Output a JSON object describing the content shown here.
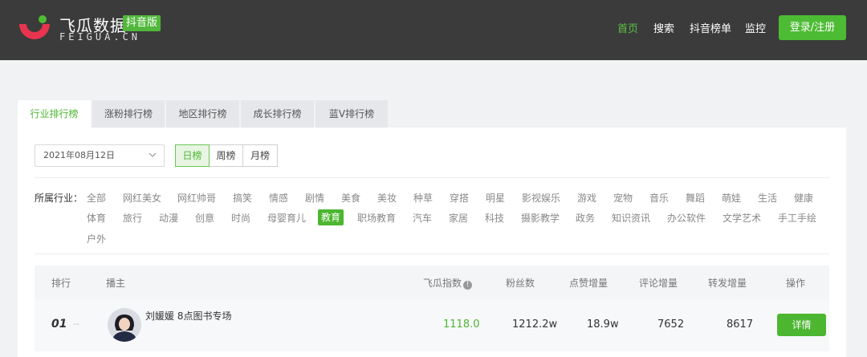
{
  "brand": {
    "name": "飞瓜数据",
    "badge": "抖音版",
    "sub": "FEIGUA.CN"
  },
  "nav": {
    "home": "首页",
    "search": "搜索",
    "rank": "抖音榜单",
    "monitor": "监控",
    "login": "登录/注册"
  },
  "tabs": [
    "行业排行榜",
    "涨粉排行榜",
    "地区排行榜",
    "成长排行榜",
    "蓝V排行榜"
  ],
  "filters": {
    "date": "2021年08月12日",
    "periods": [
      "日榜",
      "周榜",
      "月榜"
    ]
  },
  "industry": {
    "label": "所属行业：",
    "categories": [
      "全部",
      "网红美女",
      "网红帅哥",
      "搞笑",
      "情感",
      "剧情",
      "美食",
      "美妆",
      "种草",
      "穿搭",
      "明星",
      "影视娱乐",
      "游戏",
      "宠物",
      "音乐",
      "舞蹈",
      "萌娃",
      "生活",
      "健康",
      "体育",
      "旅行",
      "动漫",
      "创意",
      "时尚",
      "母婴育儿",
      "教育",
      "职场教育",
      "汽车",
      "家居",
      "科技",
      "摄影教学",
      "政务",
      "知识资讯",
      "办公软件",
      "文学艺术",
      "手工手绘",
      "户外"
    ],
    "active": "教育"
  },
  "table": {
    "headers": {
      "rank": "排行",
      "streamer": "播主",
      "index": "飞瓜指数",
      "fans": "粉丝数",
      "likes": "点赞增量",
      "comments": "评论增量",
      "shares": "转发增量",
      "action": "操作"
    },
    "rows": [
      {
        "rank": "01",
        "trend": "--",
        "name": "刘媛媛 8点图书专场",
        "index": "1118.0",
        "fans": "1212.2w",
        "likes": "18.9w",
        "comments": "7652",
        "shares": "8617",
        "action": "详情"
      }
    ]
  },
  "colors": {
    "accent": "#4cb630",
    "header_bg": "#3b3b3b",
    "logo_red": "#e8344e"
  }
}
